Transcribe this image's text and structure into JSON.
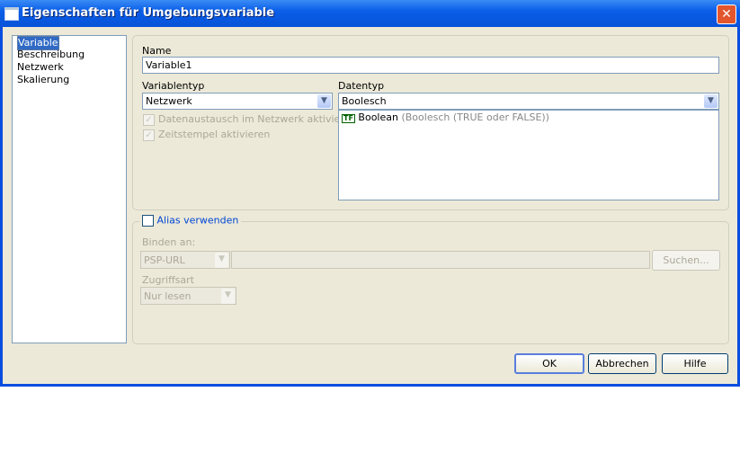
{
  "window": {
    "title": "Eigenschaften für Umgebungsvariable",
    "close": "✕"
  },
  "nav": {
    "items": [
      "Variable",
      "Beschreibung",
      "Netzwerk",
      "Skalierung"
    ]
  },
  "name": {
    "label": "Name",
    "value": "Variable1"
  },
  "variablentyp": {
    "label": "Variablentyp",
    "value": "Netzwerk",
    "checkbox1": "Datenaustausch im Netzwerk aktivieren",
    "checkbox2": "Zeitstempel aktivieren"
  },
  "datentyp": {
    "label": "Datentyp",
    "value": "Boolesch",
    "list": [
      {
        "icon": "TF",
        "name": "Boolean",
        "desc": "(Boolesch (TRUE oder FALSE))"
      }
    ]
  },
  "alias": {
    "label": "Alias verwenden",
    "bind_label": "Binden an:",
    "bind_type": "PSP-URL",
    "bind_value": "",
    "search": "Suchen...",
    "access_label": "Zugriffsart",
    "access_value": "Nur lesen"
  },
  "buttons": {
    "ok": "OK",
    "cancel": "Abbrechen",
    "help": "Hilfe"
  }
}
